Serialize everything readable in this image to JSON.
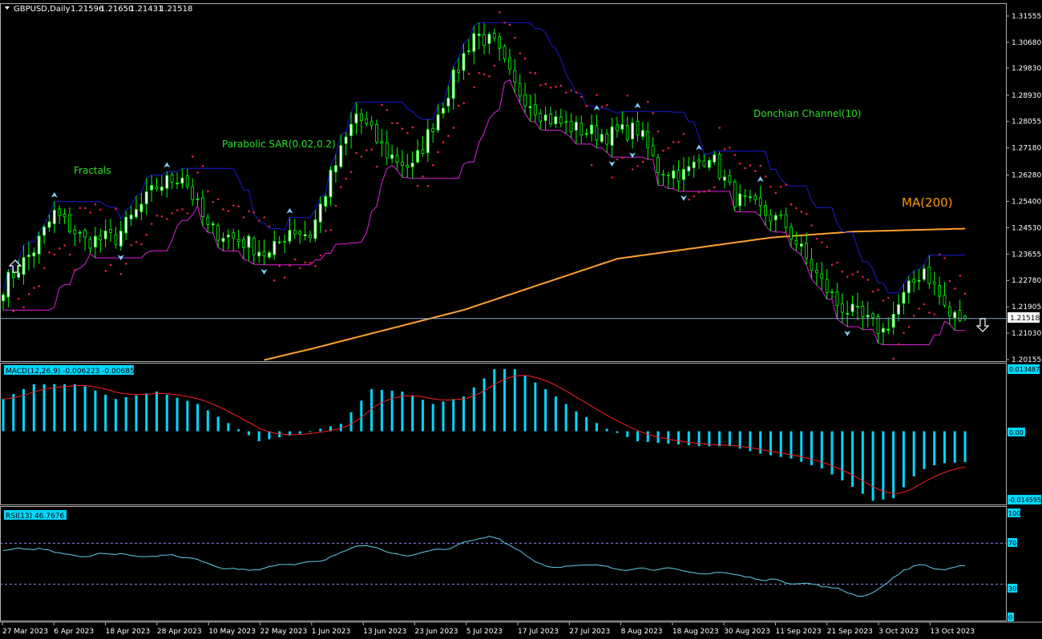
{
  "chart_data": {
    "type": "candlestick",
    "symbol_header": "GBPUSD,Daily",
    "ohlc_header": [
      "1.21596",
      "1.21650",
      "1.21431",
      "1.21518"
    ],
    "x_ticks": [
      "27 Mar 2023",
      "6 Apr 2023",
      "18 Apr 2023",
      "28 Apr 2023",
      "10 May 2023",
      "22 May 2023",
      "1 Jun 2023",
      "13 Jun 2023",
      "23 Jun 2023",
      "5 Jul 2023",
      "17 Jul 2023",
      "27 Jul 2023",
      "8 Aug 2023",
      "18 Aug 2023",
      "30 Aug 2023",
      "11 Sep 2023",
      "21 Sep 2023",
      "3 Oct 2023",
      "13 Oct 2023"
    ],
    "price_ticks": [
      "1.31555",
      "1.30680",
      "1.29830",
      "1.28930",
      "1.28055",
      "1.27180",
      "1.26280",
      "1.25400",
      "1.24530",
      "1.23655",
      "1.22780",
      "1.21905",
      "1.21030",
      "1.20155"
    ],
    "price_range": [
      1.2011,
      1.3191
    ],
    "current_price": "1.21518",
    "anchors": [
      [
        0,
        1.226
      ],
      [
        6,
        1.238
      ],
      [
        10,
        1.25
      ],
      [
        16,
        1.241
      ],
      [
        22,
        1.242
      ],
      [
        30,
        1.259
      ],
      [
        35,
        1.263
      ],
      [
        40,
        1.245
      ],
      [
        48,
        1.24
      ],
      [
        52,
        1.236
      ],
      [
        56,
        1.245
      ],
      [
        60,
        1.243
      ],
      [
        64,
        1.262
      ],
      [
        69,
        1.283
      ],
      [
        75,
        1.27
      ],
      [
        80,
        1.265
      ],
      [
        86,
        1.287
      ],
      [
        92,
        1.31
      ],
      [
        96,
        1.306
      ],
      [
        100,
        1.292
      ],
      [
        106,
        1.282
      ],
      [
        112,
        1.278
      ],
      [
        118,
        1.276
      ],
      [
        124,
        1.278
      ],
      [
        128,
        1.265
      ],
      [
        133,
        1.263
      ],
      [
        138,
        1.27
      ],
      [
        143,
        1.255
      ],
      [
        148,
        1.251
      ],
      [
        153,
        1.246
      ],
      [
        158,
        1.232
      ],
      [
        163,
        1.22
      ],
      [
        167,
        1.216
      ],
      [
        172,
        1.211
      ],
      [
        177,
        1.225
      ],
      [
        180,
        1.232
      ],
      [
        185,
        1.216
      ],
      [
        188,
        1.215
      ]
    ],
    "ma_anchors": [
      [
        0,
        1.193
      ],
      [
        40,
        1.197
      ],
      [
        60,
        1.205
      ],
      [
        90,
        1.218
      ],
      [
        120,
        1.235
      ],
      [
        150,
        1.242
      ],
      [
        166,
        1.244
      ],
      [
        188,
        1.245
      ]
    ],
    "macd": {
      "label": "MACD(12,26,9) -0.006223 -0.006851",
      "top_value": "0.013487",
      "zero_value": "0.00",
      "bottom_value": "-0.014595",
      "range": [
        -0.014595,
        0.013487
      ],
      "anchors": [
        [
          0,
          0.0065
        ],
        [
          6,
          0.0095
        ],
        [
          15,
          0.0095
        ],
        [
          22,
          0.0065
        ],
        [
          30,
          0.008
        ],
        [
          38,
          0.0055
        ],
        [
          45,
          0.001
        ],
        [
          50,
          -0.002
        ],
        [
          58,
          -0.0005
        ],
        [
          66,
          0.0015
        ],
        [
          72,
          0.0085
        ],
        [
          78,
          0.008
        ],
        [
          84,
          0.0055
        ],
        [
          90,
          0.007
        ],
        [
          96,
          0.0125
        ],
        [
          100,
          0.0125
        ],
        [
          106,
          0.0085
        ],
        [
          112,
          0.004
        ],
        [
          118,
          0.0005
        ],
        [
          124,
          -0.002
        ],
        [
          130,
          -0.0025
        ],
        [
          136,
          -0.003
        ],
        [
          142,
          -0.003
        ],
        [
          148,
          -0.0045
        ],
        [
          154,
          -0.0055
        ],
        [
          160,
          -0.0075
        ],
        [
          165,
          -0.0105
        ],
        [
          170,
          -0.014
        ],
        [
          174,
          -0.0135
        ],
        [
          179,
          -0.008
        ],
        [
          183,
          -0.0065
        ],
        [
          188,
          -0.0062
        ]
      ]
    },
    "rsi": {
      "label": "RSI(13) 46.7676",
      "ticks": [
        "100",
        "70",
        "30",
        "0"
      ],
      "levels": [
        70,
        30
      ],
      "anchors": [
        [
          0,
          62
        ],
        [
          8,
          65
        ],
        [
          15,
          58
        ],
        [
          22,
          60
        ],
        [
          30,
          58
        ],
        [
          37,
          56
        ],
        [
          42,
          48
        ],
        [
          47,
          44
        ],
        [
          52,
          46
        ],
        [
          58,
          52
        ],
        [
          64,
          56
        ],
        [
          69,
          68
        ],
        [
          75,
          62
        ],
        [
          80,
          58
        ],
        [
          86,
          64
        ],
        [
          92,
          72
        ],
        [
          96,
          78
        ],
        [
          100,
          66
        ],
        [
          105,
          50
        ],
        [
          110,
          46
        ],
        [
          116,
          48
        ],
        [
          122,
          46
        ],
        [
          128,
          46
        ],
        [
          134,
          40
        ],
        [
          140,
          42
        ],
        [
          146,
          36
        ],
        [
          152,
          34
        ],
        [
          158,
          30
        ],
        [
          164,
          24
        ],
        [
          168,
          18
        ],
        [
          172,
          28
        ],
        [
          176,
          44
        ],
        [
          179,
          50
        ],
        [
          183,
          44
        ],
        [
          188,
          46
        ]
      ]
    },
    "annotations": [
      "Fractals",
      "Parabolic SAR(0.02,0.2)",
      "Donchian Channel(10)",
      "MA(200)"
    ],
    "colors": {
      "background": "#000000",
      "bull_candle": "#ffffff",
      "bear_candle": "#000000",
      "wick": "#00ff00",
      "macd_histogram": "#00d8ff",
      "macd_signal": "#ff2020",
      "rsi_line": "#5ecfe8",
      "ma200": "#ffa030",
      "donchian_upper": "#1a1ad8",
      "donchian_lower": "#dd22dd",
      "sar": "#ff2244",
      "fractal": "#7fd0ff",
      "label_text": "#27e027",
      "ma_label": "#ff9900",
      "price_line": "#8aa0c8",
      "level_dash": "#8a8aff"
    }
  }
}
